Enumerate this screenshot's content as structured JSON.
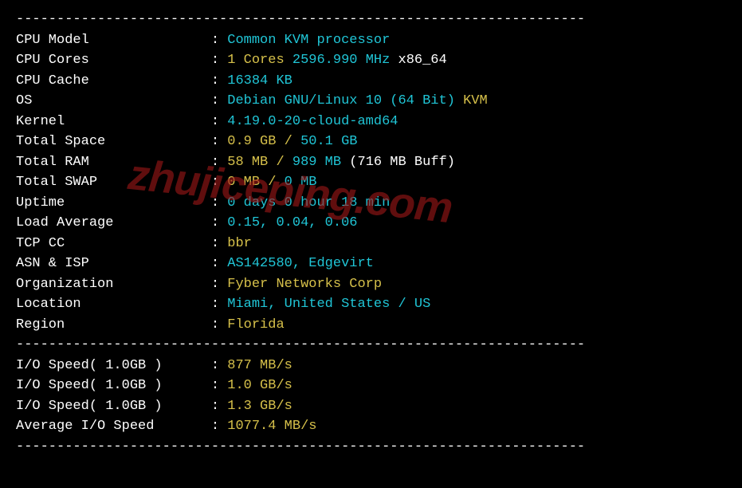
{
  "divider": "----------------------------------------------------------------------",
  "sysinfo": [
    {
      "label": "CPU Model",
      "segments": [
        {
          "text": "Common KVM processor",
          "cls": "cyan"
        }
      ]
    },
    {
      "label": "CPU Cores",
      "segments": [
        {
          "text": "1 Cores",
          "cls": "yellow"
        },
        {
          "text": " 2596.990 MHz ",
          "cls": "cyan"
        },
        {
          "text": "x86_64",
          "cls": "white"
        }
      ]
    },
    {
      "label": "CPU Cache",
      "segments": [
        {
          "text": "16384 KB",
          "cls": "cyan"
        }
      ]
    },
    {
      "label": "OS",
      "segments": [
        {
          "text": "Debian GNU/Linux 10 (64 Bit) ",
          "cls": "cyan"
        },
        {
          "text": "KVM",
          "cls": "yellow"
        }
      ]
    },
    {
      "label": "Kernel",
      "segments": [
        {
          "text": "4.19.0-20-cloud-amd64",
          "cls": "cyan"
        }
      ]
    },
    {
      "label": "Total Space",
      "segments": [
        {
          "text": "0.9 GB / ",
          "cls": "yellow"
        },
        {
          "text": "50.1 GB",
          "cls": "cyan"
        }
      ]
    },
    {
      "label": "Total RAM",
      "segments": [
        {
          "text": "58 MB / ",
          "cls": "yellow"
        },
        {
          "text": "989 MB ",
          "cls": "cyan"
        },
        {
          "text": "(716 MB Buff)",
          "cls": "white"
        }
      ]
    },
    {
      "label": "Total SWAP",
      "segments": [
        {
          "text": "0 MB / ",
          "cls": "yellow"
        },
        {
          "text": "0 MB",
          "cls": "cyan"
        }
      ]
    },
    {
      "label": "Uptime",
      "segments": [
        {
          "text": "0 days 0 hour 18 min",
          "cls": "cyan"
        }
      ]
    },
    {
      "label": "Load Average",
      "segments": [
        {
          "text": "0.15, 0.04, 0.06",
          "cls": "cyan"
        }
      ]
    },
    {
      "label": "TCP CC",
      "segments": [
        {
          "text": "bbr",
          "cls": "yellow"
        }
      ]
    },
    {
      "label": "ASN & ISP",
      "segments": [
        {
          "text": "AS142580, Edgevirt",
          "cls": "cyan"
        }
      ]
    },
    {
      "label": "Organization",
      "segments": [
        {
          "text": "Fyber Networks Corp",
          "cls": "yellow"
        }
      ]
    },
    {
      "label": "Location",
      "segments": [
        {
          "text": "Miami, United States / US",
          "cls": "cyan"
        }
      ]
    },
    {
      "label": "Region",
      "segments": [
        {
          "text": "Florida",
          "cls": "yellow"
        }
      ]
    }
  ],
  "iospeed": [
    {
      "label": "I/O Speed( 1.0GB )",
      "segments": [
        {
          "text": "877 MB/s",
          "cls": "yellow"
        }
      ]
    },
    {
      "label": "I/O Speed( 1.0GB )",
      "segments": [
        {
          "text": "1.0 GB/s",
          "cls": "yellow"
        }
      ]
    },
    {
      "label": "I/O Speed( 1.0GB )",
      "segments": [
        {
          "text": "1.3 GB/s",
          "cls": "yellow"
        }
      ]
    },
    {
      "label": "Average I/O Speed",
      "segments": [
        {
          "text": "1077.4 MB/s",
          "cls": "yellow"
        }
      ]
    }
  ],
  "watermark": "zhujiceping.com"
}
